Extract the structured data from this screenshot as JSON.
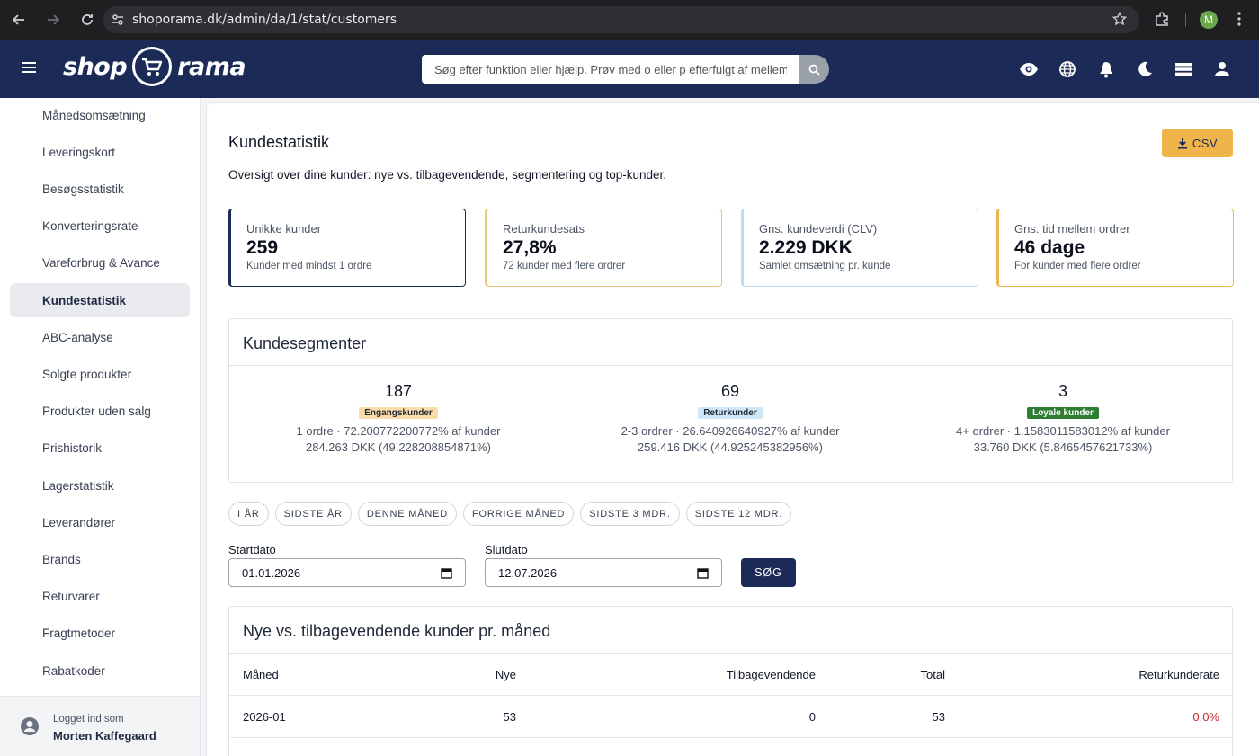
{
  "browser": {
    "url": "shoporama.dk/admin/da/1/stat/customers",
    "profile_initial": "M"
  },
  "header": {
    "logo_left": "shop",
    "logo_right": "rama",
    "search_placeholder": "Søg efter funktion eller hjælp. Prøv med o eller p efterfulgt af mellemrum"
  },
  "sidebar": {
    "items": [
      {
        "label": "Månedsomsætning"
      },
      {
        "label": "Leveringskort"
      },
      {
        "label": "Besøgsstatistik"
      },
      {
        "label": "Konverteringsrate"
      },
      {
        "label": "Vareforbrug & Avance"
      },
      {
        "label": "Kundestatistik",
        "active": true
      },
      {
        "label": "ABC-analyse"
      },
      {
        "label": "Solgte produkter"
      },
      {
        "label": "Produkter uden salg"
      },
      {
        "label": "Prishistorik"
      },
      {
        "label": "Lagerstatistik"
      },
      {
        "label": "Leverandører"
      },
      {
        "label": "Brands"
      },
      {
        "label": "Returvarer"
      },
      {
        "label": "Fragtmetoder"
      },
      {
        "label": "Rabatkoder"
      }
    ],
    "user": {
      "logged_in_label": "Logget ind som",
      "name": "Morten Kaffegaard"
    }
  },
  "page": {
    "title": "Kundestatistik",
    "description": "Oversigt over dine kunder: nye vs. tilbagevendende, segmentering og top-kunder.",
    "csv_label": "CSV"
  },
  "kpis": [
    {
      "label": "Unikke kunder",
      "value": "259",
      "sub": "Kunder med mindst 1 ordre",
      "color": "#1b2a56"
    },
    {
      "label": "Returkundesats",
      "value": "27,8%",
      "sub": "72 kunder med flere ordrer",
      "color": "#f0c27a"
    },
    {
      "label": "Gns. kundeverdi (CLV)",
      "value": "2.229 DKK",
      "sub": "Samlet omsætning pr. kunde",
      "color": "#b9dcf2"
    },
    {
      "label": "Gns. tid mellem ordrer",
      "value": "46 dage",
      "sub": "For kunder med flere ordrer",
      "color": "#f0b54a"
    }
  ],
  "segments": {
    "title": "Kundesegmenter",
    "items": [
      {
        "count": "187",
        "badge": "Engangskunder",
        "line1": "1 ordre · 72.200772200772% af kunder",
        "line2": "284.263 DKK (49.228208854871%)",
        "badge_bg": "#fbdba8",
        "badge_fg": "#1f2937"
      },
      {
        "count": "69",
        "badge": "Returkunder",
        "line1": "2-3 ordrer · 26.640926640927% af kunder",
        "line2": "259.416 DKK (44.925245382956%)",
        "badge_bg": "#cfe6f7",
        "badge_fg": "#1f2937"
      },
      {
        "count": "3",
        "badge": "Loyale kunder",
        "line1": "4+ ordrer · 1.1583011583012% af kunder",
        "line2": "33.760 DKK (5.8465457621733%)",
        "badge_bg": "#2e7d32",
        "badge_fg": "#ffffff"
      }
    ]
  },
  "filters": {
    "chips": [
      "I ÅR",
      "SIDSTE ÅR",
      "DENNE MÅNED",
      "FORRIGE MÅNED",
      "SIDSTE 3 MDR.",
      "SIDSTE 12 MDR."
    ],
    "start_label": "Startdato",
    "start_value": "01.01.2026",
    "end_label": "Slutdato",
    "end_value": "12.07.2026",
    "search_label": "SØG"
  },
  "monthly": {
    "title": "Nye vs. tilbagevendende kunder pr. måned",
    "columns": [
      "Måned",
      "Nye",
      "Tilbagevendende",
      "Total",
      "Returkunderate"
    ],
    "rows": [
      [
        "2026-01",
        "53",
        "0",
        "53",
        "0,0%"
      ]
    ]
  }
}
